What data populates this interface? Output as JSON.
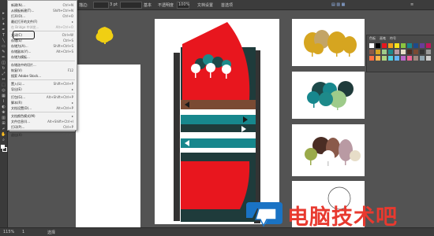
{
  "control_bar": {
    "zoom": "100%",
    "coords": "3 pt",
    "style_label": "基本",
    "opacity": "不透明度",
    "mode": "文档设置",
    "prefs": "首选项"
  },
  "menu": {
    "items": [
      {
        "label": "新建(N)...",
        "shortcut": "Ctrl+N"
      },
      {
        "label": "从模板新建(T)...",
        "shortcut": "Shift+Ctrl+N"
      },
      {
        "label": "打开(O)...",
        "shortcut": "Ctrl+O"
      },
      {
        "label": "最近打开的文件(F)",
        "shortcut": "▸"
      },
      {
        "label": "在 Bridge 中浏览...",
        "shortcut": "Alt+Ctrl+O",
        "disabled": true
      },
      {
        "label": "关闭(C)",
        "shortcut": "Ctrl+W"
      },
      {
        "label": "存储(S)",
        "shortcut": "Ctrl+S"
      },
      {
        "label": "存储为(A)...",
        "shortcut": "Shift+Ctrl+S"
      },
      {
        "label": "存储副本(Y)...",
        "shortcut": "Alt+Ctrl+S"
      },
      {
        "label": "存储为模板...",
        "shortcut": ""
      },
      {
        "label": "存储选中的切片...",
        "shortcut": ""
      },
      {
        "label": "恢复(V)",
        "shortcut": "F12"
      },
      {
        "label": "搜索 Adobe Stock...",
        "shortcut": ""
      },
      {
        "label": "置入(L)...",
        "shortcut": "Shift+Ctrl+P"
      },
      {
        "label": "导出(E)",
        "shortcut": "▸"
      },
      {
        "label": "打包(G)...",
        "shortcut": "Alt+Shift+Ctrl+P"
      },
      {
        "label": "脚本(R)",
        "shortcut": "▸"
      },
      {
        "label": "文档设置(D)...",
        "shortcut": "Alt+Ctrl+P"
      },
      {
        "label": "文档颜色模式(M)",
        "shortcut": "▸"
      },
      {
        "label": "文件信息(I)...",
        "shortcut": "Alt+Shift+Ctrl+I"
      },
      {
        "label": "打印(P)...",
        "shortcut": "Ctrl+P"
      },
      {
        "label": "退出(X)",
        "shortcut": "Ctrl+Q"
      }
    ]
  },
  "panel": {
    "tab1": "色板",
    "tab2": "画笔",
    "tab3": "符号"
  },
  "status": {
    "zoom": "115%",
    "page": "1",
    "tool": "选择"
  },
  "watermark": {
    "text": "电脑技术吧"
  },
  "colors": {
    "red": "#e8161e",
    "teal": "#17878d",
    "dark": "#1e3d3d",
    "brown": "#7a4a33",
    "yellow": "#d6a520",
    "accent": "#e8392f"
  }
}
